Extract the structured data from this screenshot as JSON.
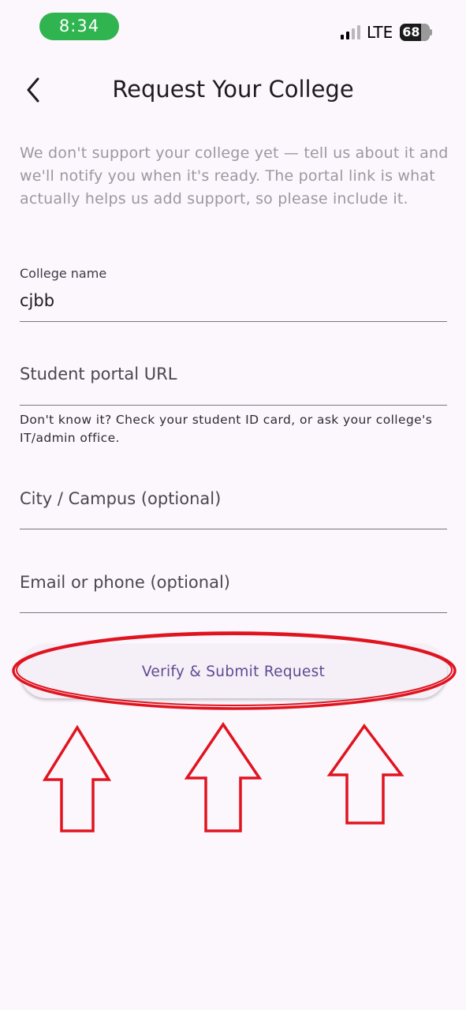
{
  "status_bar": {
    "time": "8:34",
    "network": "LTE",
    "battery": "68"
  },
  "header": {
    "back_icon": "chevron-left-icon",
    "title": "Request Your College"
  },
  "intro_text": "We don't support your college yet — tell us about it and we'll notify you when it's ready. The portal link is what actually helps us add support, so please include it.",
  "form": {
    "college_name": {
      "label": "College name",
      "value": "cjbb"
    },
    "portal_url": {
      "placeholder": "Student portal URL",
      "helper": "Don't know it? Check your student ID card, or ask your college's IT/admin office."
    },
    "city": {
      "placeholder": "City / Campus (optional)"
    },
    "contact": {
      "placeholder": "Email or phone (optional)"
    }
  },
  "submit_label": "Verify & Submit Request",
  "annotation": {
    "highlight_color": "#e0141e",
    "arrow_count": 3,
    "arrow_icon": "up-arrow-outline"
  },
  "colors": {
    "background": "#fcf6fd",
    "status_pill": "#2fb450",
    "button_text": "#5f4b93",
    "muted_text": "#9c98a1"
  }
}
